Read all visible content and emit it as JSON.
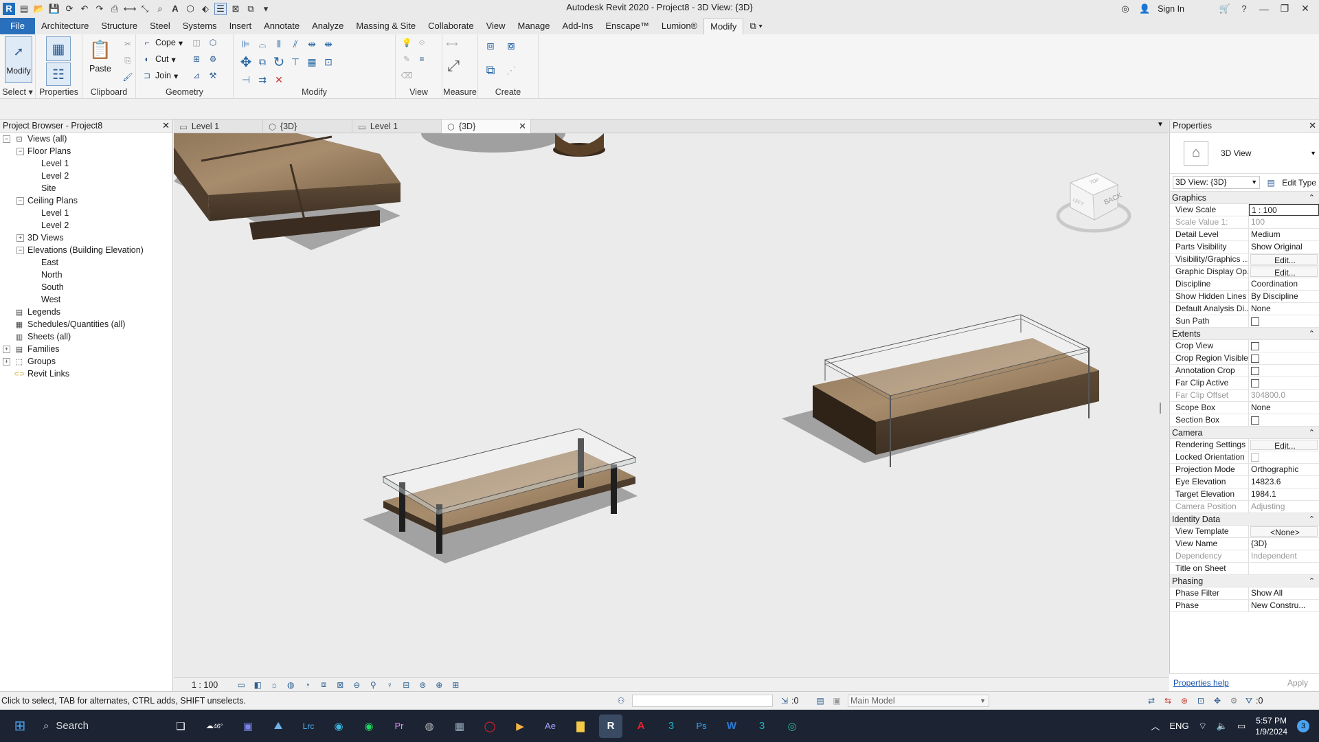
{
  "app": {
    "title": "Autodesk Revit 2020 - Project8 - 3D View: {3D}",
    "sign_in": "Sign In"
  },
  "ribbon_tabs": [
    "File",
    "Architecture",
    "Structure",
    "Steel",
    "Systems",
    "Insert",
    "Annotate",
    "Analyze",
    "Massing & Site",
    "Collaborate",
    "View",
    "Manage",
    "Add-Ins",
    "Enscape™",
    "Lumion®",
    "Modify"
  ],
  "ribbon": {
    "select": {
      "button": "Modify",
      "panel": "Select"
    },
    "properties": {
      "button": "Properties",
      "panel": "Properties"
    },
    "clipboard": {
      "button": "Paste",
      "panel": "Clipboard"
    },
    "geometry": {
      "cope": "Cope",
      "cut": "Cut",
      "join": "Join",
      "panel": "Geometry"
    },
    "modify_panel": "Modify",
    "view_panel": "View",
    "measure_panel": "Measure",
    "create_panel": "Create"
  },
  "project_browser": {
    "title": "Project Browser - Project8",
    "tree": [
      {
        "label": "Views (all)",
        "level": 0,
        "toggle": "−",
        "icon": "views-icon"
      },
      {
        "label": "Floor Plans",
        "level": 1,
        "toggle": "−"
      },
      {
        "label": "Level 1",
        "level": 2
      },
      {
        "label": "Level 2",
        "level": 2
      },
      {
        "label": "Site",
        "level": 2
      },
      {
        "label": "Ceiling Plans",
        "level": 1,
        "toggle": "−"
      },
      {
        "label": "Level 1",
        "level": 2
      },
      {
        "label": "Level 2",
        "level": 2
      },
      {
        "label": "3D Views",
        "level": 1,
        "toggle": "+"
      },
      {
        "label": "Elevations (Building Elevation)",
        "level": 1,
        "toggle": "−"
      },
      {
        "label": "East",
        "level": 2
      },
      {
        "label": "North",
        "level": 2
      },
      {
        "label": "South",
        "level": 2
      },
      {
        "label": "West",
        "level": 2
      },
      {
        "label": "Legends",
        "level": 0,
        "icon": "legend-icon"
      },
      {
        "label": "Schedules/Quantities (all)",
        "level": 0,
        "icon": "schedule-icon"
      },
      {
        "label": "Sheets (all)",
        "level": 0,
        "icon": "sheet-icon"
      },
      {
        "label": "Families",
        "level": 0,
        "toggle": "+",
        "icon": "family-icon"
      },
      {
        "label": "Groups",
        "level": 0,
        "toggle": "+",
        "icon": "group-icon"
      },
      {
        "label": "Revit Links",
        "level": 0,
        "icon": "link-icon"
      }
    ]
  },
  "view_tabs": [
    {
      "label": "Level 1",
      "icon": "floor-plan-icon",
      "active": false
    },
    {
      "label": "{3D}",
      "icon": "3d-view-icon",
      "active": false
    },
    {
      "label": "Level 1",
      "icon": "floor-plan-icon",
      "active": false
    },
    {
      "label": "{3D}",
      "icon": "3d-view-icon",
      "active": true
    }
  ],
  "viewcube": {
    "face": "BACK",
    "left": "LEFT",
    "top": "TOP"
  },
  "view_control": {
    "scale": "1 : 100"
  },
  "properties": {
    "title": "Properties",
    "type_name": "3D View",
    "instance": "3D View: {3D}",
    "edit_type": "Edit Type",
    "groups": [
      {
        "name": "Graphics",
        "rows": [
          {
            "n": "View Scale",
            "v": "1 : 100",
            "kind": "sel"
          },
          {
            "n": "Scale Value   1:",
            "v": "100",
            "kind": "dis"
          },
          {
            "n": "Detail Level",
            "v": "Medium"
          },
          {
            "n": "Parts Visibility",
            "v": "Show Original"
          },
          {
            "n": "Visibility/Graphics ...",
            "v": "Edit...",
            "kind": "btn"
          },
          {
            "n": "Graphic Display Op...",
            "v": "Edit...",
            "kind": "btn"
          },
          {
            "n": "Discipline",
            "v": "Coordination"
          },
          {
            "n": "Show Hidden Lines",
            "v": "By Discipline"
          },
          {
            "n": "Default Analysis Di...",
            "v": "None"
          },
          {
            "n": "Sun Path",
            "v": "",
            "kind": "cb"
          }
        ]
      },
      {
        "name": "Extents",
        "rows": [
          {
            "n": "Crop View",
            "v": "",
            "kind": "cb"
          },
          {
            "n": "Crop Region Visible",
            "v": "",
            "kind": "cb"
          },
          {
            "n": "Annotation Crop",
            "v": "",
            "kind": "cb"
          },
          {
            "n": "Far Clip Active",
            "v": "",
            "kind": "cb"
          },
          {
            "n": "Far Clip Offset",
            "v": "304800.0",
            "kind": "dis"
          },
          {
            "n": "Scope Box",
            "v": "None"
          },
          {
            "n": "Section Box",
            "v": "",
            "kind": "cb"
          }
        ]
      },
      {
        "name": "Camera",
        "rows": [
          {
            "n": "Rendering Settings",
            "v": "Edit...",
            "kind": "btn"
          },
          {
            "n": "Locked Orientation",
            "v": "",
            "kind": "cbdis"
          },
          {
            "n": "Projection Mode",
            "v": "Orthographic"
          },
          {
            "n": "Eye Elevation",
            "v": "14823.6"
          },
          {
            "n": "Target Elevation",
            "v": "1984.1"
          },
          {
            "n": "Camera Position",
            "v": "Adjusting",
            "kind": "dis"
          }
        ]
      },
      {
        "name": "Identity Data",
        "rows": [
          {
            "n": "View Template",
            "v": "<None>",
            "kind": "btn"
          },
          {
            "n": "View Name",
            "v": "{3D}"
          },
          {
            "n": "Dependency",
            "v": "Independent",
            "kind": "dis"
          },
          {
            "n": "Title on Sheet",
            "v": ""
          }
        ]
      },
      {
        "name": "Phasing",
        "rows": [
          {
            "n": "Phase Filter",
            "v": "Show All"
          },
          {
            "n": "Phase",
            "v": "New Constru..."
          }
        ]
      }
    ],
    "help": "Properties help",
    "apply": "Apply"
  },
  "status": {
    "hint": "Click to select, TAB for alternates, CTRL adds, SHIFT unselects.",
    "count": ":0",
    "model": "Main Model",
    "filter_count": ":0"
  },
  "taskbar": {
    "search": "Search",
    "weather": "46°",
    "lang": "ENG",
    "time": "5:57 PM",
    "date": "1/9/2024",
    "badge": "3"
  }
}
